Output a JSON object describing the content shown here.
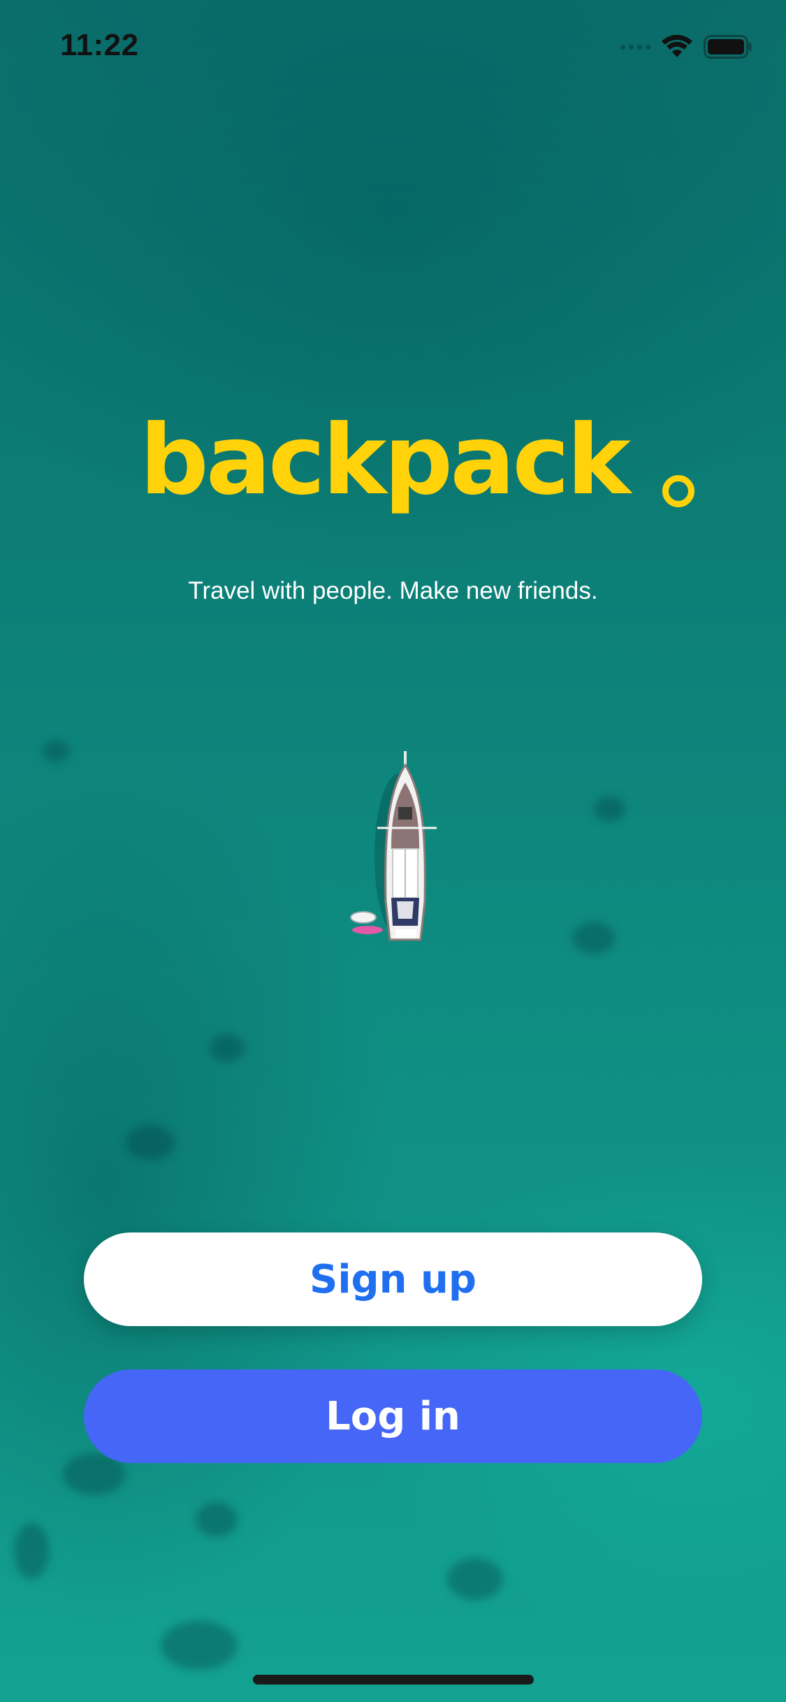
{
  "status_bar": {
    "time": "11:22",
    "icons": [
      "cellular-signal-icon",
      "wifi-icon",
      "battery-icon"
    ]
  },
  "brand": {
    "logo_text": "backpack",
    "logo_color": "#ffd20a",
    "tagline": "Travel with people. Make new friends."
  },
  "actions": {
    "signup_label": "Sign up",
    "login_label": "Log in"
  },
  "colors": {
    "background": "#0f8d82",
    "signup_bg": "#ffffff",
    "signup_text": "#1f6ff0",
    "login_bg": "#4666f7",
    "login_text": "#ffffff"
  }
}
